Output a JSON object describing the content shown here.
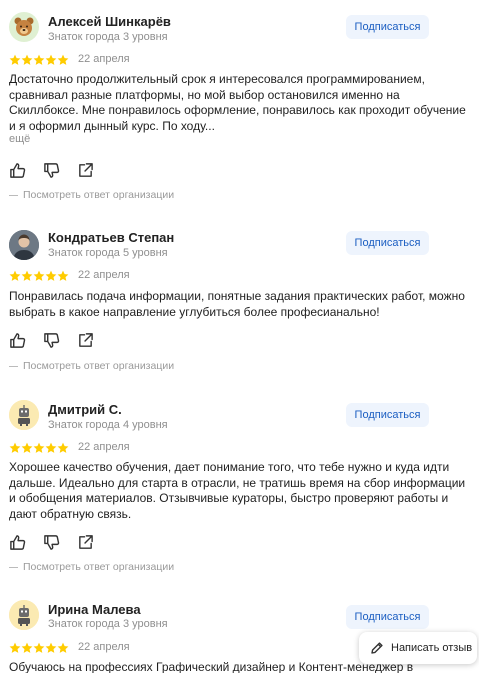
{
  "reviews": [
    {
      "author": "Алексей Шинкарёв",
      "level": "Знаток города 3 уровня",
      "avatar_icon": "bear-emoji-avatar",
      "rating": 5,
      "date": "22 апреля",
      "text": "Достаточно продолжительный срок я интересовался программированием, сравнивал разные платформы, но мой выбор остановился именно на Скиллбоксе. Мне понравилось оформление, понравилось как проходит обучение и я оформил дынный курс. По ходу...",
      "more_label": "ещё",
      "subscribe_label": "Подписаться",
      "org_reply_label": "Посмотреть ответ организации"
    },
    {
      "author": "Кондратьев Степан",
      "level": "Знаток города 5 уровня",
      "avatar_icon": "user-photo-avatar",
      "rating": 5,
      "date": "22 апреля",
      "text": "Понравилась подача информации, понятные задания практических работ, можно выбрать в какое направление углубиться более професианально!",
      "subscribe_label": "Подписаться",
      "org_reply_label": "Посмотреть ответ организации"
    },
    {
      "author": "Дмитрий С.",
      "level": "Знаток города 4 уровня",
      "avatar_icon": "robot-avatar",
      "rating": 5,
      "date": "22 апреля",
      "text": "Хорошее качество обучения, дает понимание того, что тебе нужно и куда идти дальше. Идеально для старта в отрасли, не тратишь время на сбор информации и обобщения материалов. Отзывчивые кураторы, быстро проверяют работы и дают обратную связь.",
      "subscribe_label": "Подписаться",
      "org_reply_label": "Посмотреть ответ организации"
    },
    {
      "author": "Ирина Малева",
      "level": "Знаток города 3 уровня",
      "avatar_icon": "robot-avatar",
      "rating": 5,
      "date": "22 апреля",
      "text": "Обучаюсь на профессиях Графический дизайнер и Контент-менеджер в",
      "subscribe_label": "Подписаться"
    }
  ],
  "write_review_label": "Написать отзыв",
  "colors": {
    "star": "#fc0",
    "subscribe_bg": "#eef4fd",
    "subscribe_text": "#1b5ec2",
    "muted": "#8f8f8f"
  }
}
